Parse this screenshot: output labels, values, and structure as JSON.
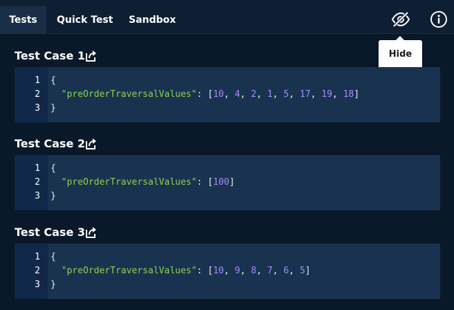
{
  "tabs": [
    {
      "label": "Tests",
      "active": true
    },
    {
      "label": "Quick Test",
      "active": false
    },
    {
      "label": "Sandbox",
      "active": false
    }
  ],
  "toolbar": {
    "hide_icon": "eye-off-icon",
    "info_icon": "info-icon",
    "tooltip": "Hide"
  },
  "test_cases": [
    {
      "title": "Test Case 1",
      "key": "\"preOrderTraversalValues\"",
      "values": [
        "10",
        "4",
        "2",
        "1",
        "5",
        "17",
        "19",
        "18"
      ]
    },
    {
      "title": "Test Case 2",
      "key": "\"preOrderTraversalValues\"",
      "values": [
        "100"
      ]
    },
    {
      "title": "Test Case 3",
      "key": "\"preOrderTraversalValues\"",
      "values": [
        "10",
        "9",
        "8",
        "7",
        "6",
        "5"
      ]
    }
  ],
  "line_numbers": [
    "1",
    "2",
    "3"
  ],
  "code": {
    "open_brace": "{",
    "close_brace": "}"
  },
  "colors": {
    "background": "#0a1929",
    "topbar": "#0e1f33",
    "code_bg": "#19324f",
    "gutter_bg": "#10284a",
    "key": "#8fd14f",
    "number": "#a78bfa"
  }
}
